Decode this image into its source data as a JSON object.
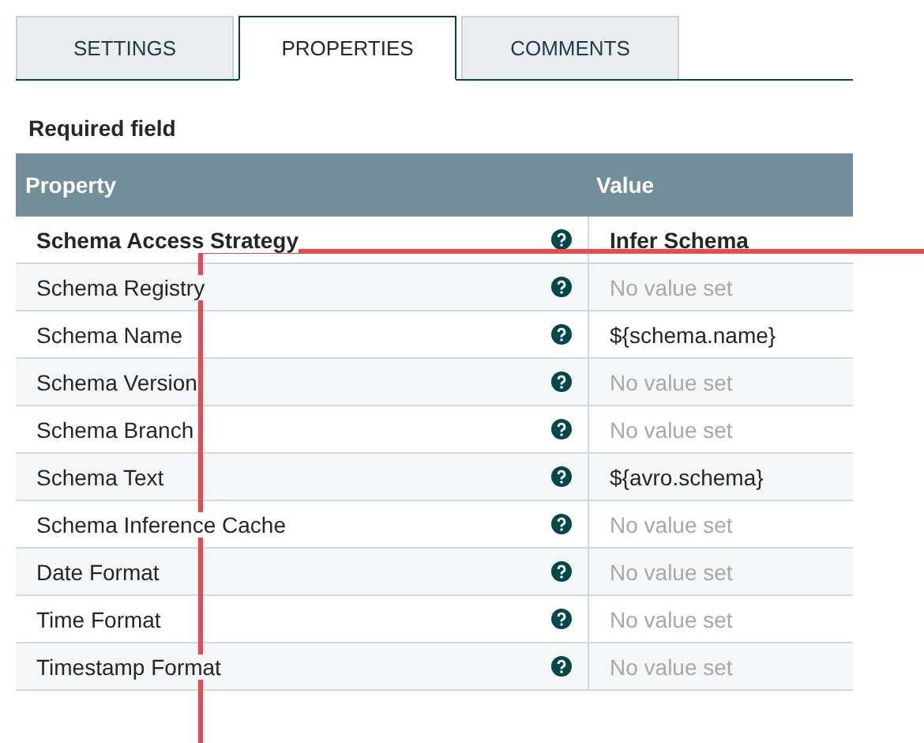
{
  "tabs": [
    {
      "label": "SETTINGS",
      "selected": false
    },
    {
      "label": "PROPERTIES",
      "selected": true
    },
    {
      "label": "COMMENTS",
      "selected": false
    }
  ],
  "legend": "Required field",
  "table": {
    "columns": [
      "Property",
      "Value"
    ],
    "rows": [
      {
        "property": "Schema Access Strategy",
        "required": true,
        "value": "Infer Schema",
        "value_set": true
      },
      {
        "property": "Schema Registry",
        "required": false,
        "value": "No value set",
        "value_set": false
      },
      {
        "property": "Schema Name",
        "required": false,
        "value": "${schema.name}",
        "value_set": true
      },
      {
        "property": "Schema Version",
        "required": false,
        "value": "No value set",
        "value_set": false
      },
      {
        "property": "Schema Branch",
        "required": false,
        "value": "No value set",
        "value_set": false
      },
      {
        "property": "Schema Text",
        "required": false,
        "value": "${avro.schema}",
        "value_set": true
      },
      {
        "property": "Schema Inference Cache",
        "required": false,
        "value": "No value set",
        "value_set": false
      },
      {
        "property": "Date Format",
        "required": false,
        "value": "No value set",
        "value_set": false
      },
      {
        "property": "Time Format",
        "required": false,
        "value": "No value set",
        "value_set": false
      },
      {
        "property": "Timestamp Format",
        "required": false,
        "value": "No value set",
        "value_set": false
      }
    ]
  }
}
